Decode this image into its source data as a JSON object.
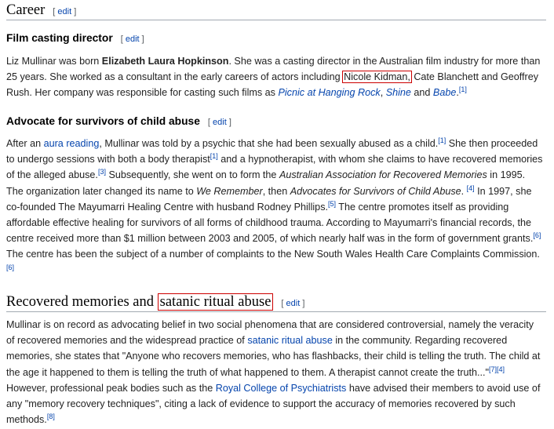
{
  "career": {
    "heading": "Career",
    "edit": "edit"
  },
  "film": {
    "heading": "Film casting director",
    "edit": "edit",
    "p1_a": "Liz Mullinar was born ",
    "p1_name": "Elizabeth Laura Hopkinson",
    "p1_b": ". She was a casting director in the Australian film industry for more than 25 years. She worked as a consultant in the early careers of actors including ",
    "p1_kidman": "Nicole Kidman,",
    "p1_c": " Cate Blanchett and Geoffrey Rush. Her company was responsible for casting such films as ",
    "p1_film1": "Picnic at Hanging Rock",
    "p1_sep1": ", ",
    "p1_film2": "Shine",
    "p1_and": " and ",
    "p1_film3": "Babe",
    "p1_end": ".",
    "p1_ref": "[1]"
  },
  "advocate": {
    "heading": "Advocate for survivors of child abuse",
    "edit": "edit",
    "t1": "After an ",
    "aura": "aura reading",
    "t2": ", Mullinar was told by a psychic that she had been sexually abused as a child.",
    "r1": "[1]",
    "t3": " She then proceeded to undergo sessions with both a body therapist",
    "r2": "[1]",
    "t4": " and a hypnotherapist, with whom she claims to have recovered memories of the alleged abuse.",
    "r3": "[3]",
    "t5": " Subsequently, she went on to form the ",
    "org1": "Australian Association for Recovered Memories",
    "t6": " in 1995. The organization later changed its name to ",
    "org2": "We Remember",
    "t7": ", then ",
    "org3": "Advocates for Survivors of Child Abuse",
    "t8": ". ",
    "r4": "[4]",
    "t9": " In 1997, she co-founded The Mayumarri Healing Centre with husband Rodney Phillips.",
    "r5": "[5]",
    "t10": " The centre promotes itself as providing affordable effective healing for survivors of all forms of childhood trauma. According to Mayumarri's financial records, the centre received more than $1 million between 2003 and 2005, of which nearly half was in the form of government grants.",
    "r6": "[6]",
    "t11": " The centre has been the subject of a number of complaints to the New South Wales Health Care Complaints Commission.",
    "r7": "[6]"
  },
  "recovered": {
    "heading_a": "Recovered memories and ",
    "heading_b": "satanic ritual abuse",
    "edit": "edit",
    "t1": "Mullinar is on record as advocating belief in two social phenomena that are considered controversial, namely the veracity of recovered memories and the widespread practice of ",
    "sra": "satanic ritual abuse",
    "t2": " in the community. Regarding recovered memories, she states that \"Anyone who recovers memories, who has flashbacks, their child is telling the truth. The child at the age it happened to them is telling the truth of what happened to them. A therapist cannot create the truth...\"",
    "r1": "[7]",
    "r2": "[4]",
    "t3": " However, professional peak bodies such as the ",
    "rcp": "Royal College of Psychiatrists",
    "t4": " have advised their members to avoid use of any \"memory recovery techniques\", citing a lack of evidence to support the accuracy of memories recovered by such methods.",
    "r3": "[8]"
  }
}
